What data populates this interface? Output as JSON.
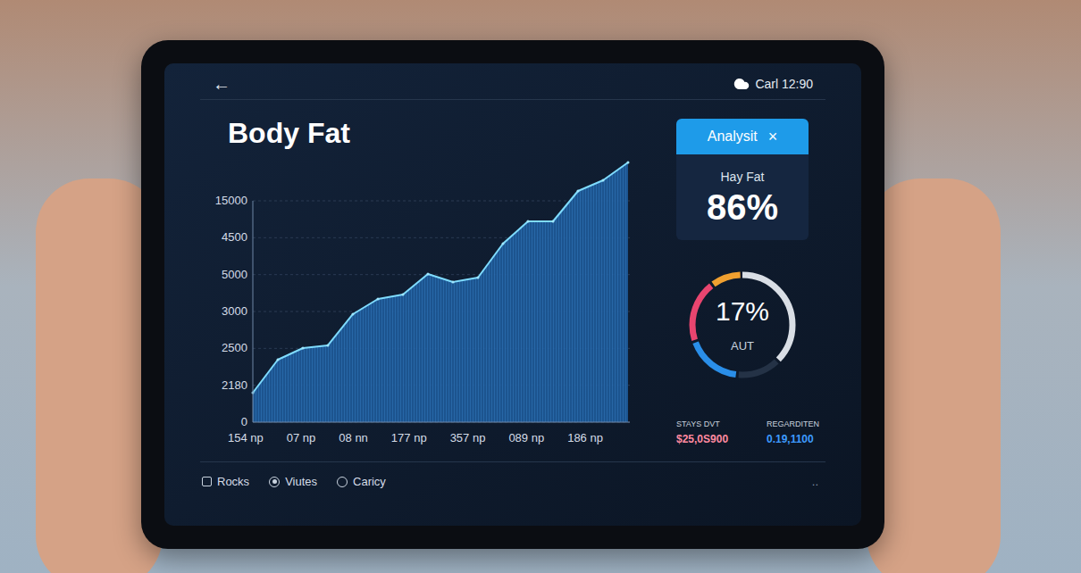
{
  "topbar": {
    "back": "←",
    "status": "Carl 12:90"
  },
  "title": "Body Fat",
  "chart": {
    "y_ticks": [
      "15000",
      "4500",
      "5000",
      "3000",
      "2500",
      "2180",
      "0"
    ],
    "x_ticks": [
      "154 np",
      "07 np",
      "08 nn",
      "177 np",
      "357 np",
      "089 np",
      "186 np"
    ],
    "series": [
      {
        "name": "Body Fat",
        "values": [
          1996,
          4234,
          5020,
          5202,
          7319,
          8347,
          8649,
          10040,
          9496,
          9798,
          12097,
          13609,
          13609,
          15665,
          16391,
          17601
        ]
      }
    ]
  },
  "analysis": {
    "button": "Analysit",
    "close": "×",
    "label": "Hay Fat",
    "value": "86%"
  },
  "gauge": {
    "value": "17%",
    "label": "AUT",
    "segments": [
      {
        "level": 0.38,
        "color": "#d9dee5"
      },
      {
        "level": 0.14,
        "color": "#243246"
      },
      {
        "level": 0.18,
        "color": "#2a8ee8"
      },
      {
        "level": 0.2,
        "color": "#e8456f"
      },
      {
        "level": 0.1,
        "color": "#f0a030"
      }
    ]
  },
  "stats": [
    {
      "label": "STAYS DVT",
      "value": "$25,0S900",
      "color": "#ff8aa0"
    },
    {
      "label": "REGARDITEN",
      "value": "0.19,1100",
      "color": "#3d9bff"
    }
  ],
  "footer": {
    "options": [
      {
        "label": "Rocks",
        "kind": "checkbox",
        "selected": false
      },
      {
        "label": "Viutes",
        "kind": "radio",
        "selected": true
      },
      {
        "label": "Cariсy",
        "kind": "radio",
        "selected": false
      }
    ],
    "more": ".."
  }
}
